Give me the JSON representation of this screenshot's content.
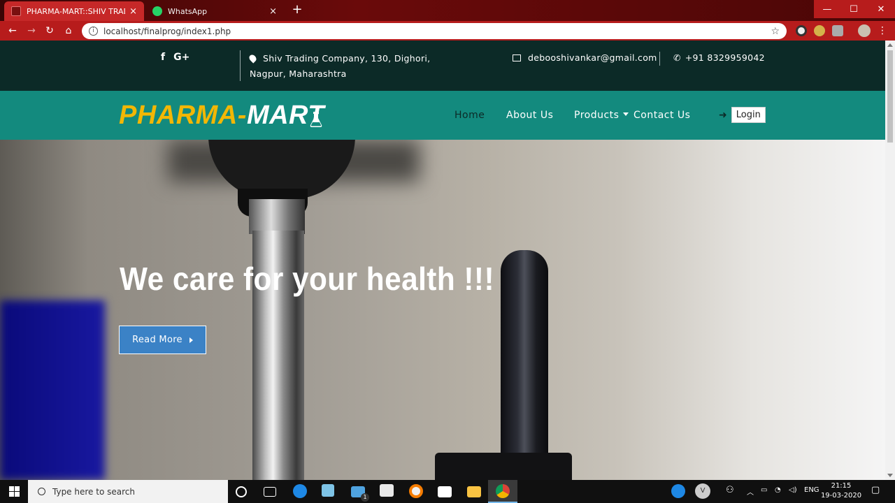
{
  "browser": {
    "tabs": [
      {
        "title": "PHARMA-MART::SHIV TRADING",
        "close": "×"
      },
      {
        "title": "WhatsApp",
        "close": "×"
      }
    ],
    "new_tab": "+",
    "window_controls": {
      "minimize": "—",
      "maximize": "☐",
      "close": "✕"
    },
    "url": "localhost/finalprog/index1.php",
    "nav": {
      "back": "←",
      "forward": "→",
      "reload": "↻",
      "home": "⌂"
    },
    "bookmark_star": "☆",
    "menu": "⋮"
  },
  "topbar": {
    "social": {
      "facebook": "f",
      "google_plus": "G+"
    },
    "address_line1": "Shiv Trading Company, 130, Dighori,",
    "address_line2": "Nagpur, Maharashtra",
    "email": "debooshivankar@gmail.com",
    "phone": "+91 8329959042"
  },
  "navbar": {
    "logo_part1": "PHARMA-",
    "logo_part2": "MART",
    "items": [
      {
        "label": "Home"
      },
      {
        "label": "About Us"
      },
      {
        "label": "Products"
      },
      {
        "label": "Contact Us"
      }
    ],
    "login_label": "Login"
  },
  "hero": {
    "title": "We care for your health !!!",
    "button_label": "Read More"
  },
  "taskbar": {
    "search_placeholder": "Type here to search",
    "mail_badge": "1",
    "user_initial": "V",
    "language": "ENG",
    "time": "21:15",
    "date": "19-03-2020"
  },
  "colors": {
    "topbar_bg": "#0c2a27",
    "navbar_bg": "#138a7e",
    "logo_accent": "#f2b705",
    "button_blue": "#3b82c6",
    "browser_red": "#b71c1c"
  }
}
